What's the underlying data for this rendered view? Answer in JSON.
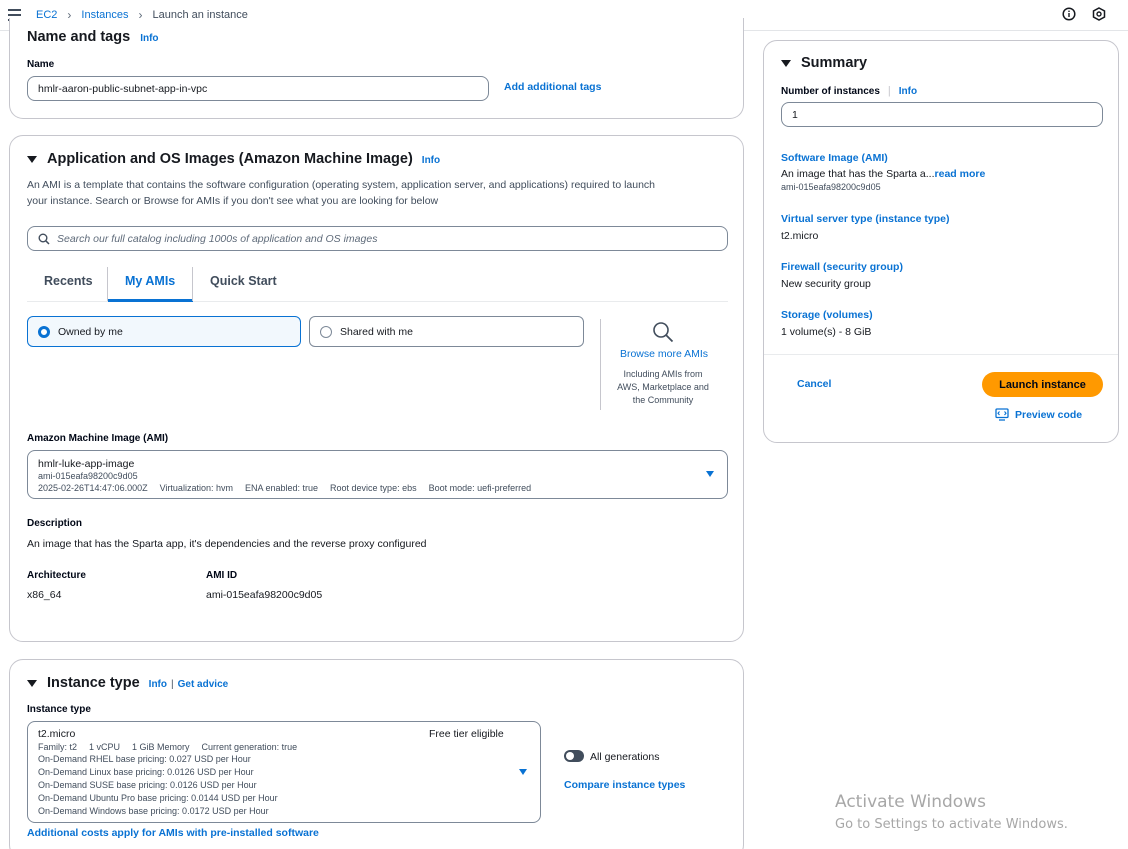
{
  "breadcrumb": {
    "ec2": "EC2",
    "instances": "Instances",
    "current": "Launch an instance"
  },
  "name_tags": {
    "title": "Name and tags",
    "info": "Info",
    "name_label": "Name",
    "name_value": "hmlr-aaron-public-subnet-app-in-vpc",
    "add_tags": "Add additional tags"
  },
  "ami_section": {
    "title": "Application and OS Images (Amazon Machine Image)",
    "info": "Info",
    "desc_line1": "An AMI is a template that contains the software configuration (operating system, application server, and applications) required to launch",
    "desc_line2": "your instance. Search or Browse for AMIs if you don't see what you are looking for below",
    "search_placeholder": "Search our full catalog including 1000s of application and OS images",
    "tabs": [
      "Recents",
      "My AMIs",
      "Quick Start"
    ],
    "owned_by_me": "Owned by me",
    "shared_with_me": "Shared with me",
    "browse_more": "Browse more AMIs",
    "browse_sub1": "Including AMIs from",
    "browse_sub2": "AWS, Marketplace and",
    "browse_sub3": "the Community",
    "ami_label": "Amazon Machine Image (AMI)",
    "ami_name": "hmlr-luke-app-image",
    "ami_id_line": "ami-015eafa98200c9d05",
    "ami_meta": {
      "date": "2025-02-26T14:47:06.000Z",
      "virt": "Virtualization: hvm",
      "ena": "ENA enabled: true",
      "root": "Root device type: ebs",
      "boot": "Boot mode: uefi-preferred"
    },
    "description_label": "Description",
    "description": "An image that has the Sparta app, it's dependencies and the reverse proxy configured",
    "arch_label": "Architecture",
    "arch_value": "x86_64",
    "amiid_label": "AMI ID",
    "amiid_value": "ami-015eafa98200c9d05"
  },
  "instance_type": {
    "title": "Instance type",
    "info": "Info",
    "get_advice": "Get advice",
    "label": "Instance type",
    "selected": "t2.micro",
    "free_tier": "Free tier eligible",
    "family_line": {
      "family": "Family: t2",
      "vcpu": "1 vCPU",
      "memory": "1 GiB Memory",
      "generation": "Current generation: true"
    },
    "pricing": [
      "On-Demand RHEL base pricing: 0.027 USD per Hour",
      "On-Demand Linux base pricing: 0.0126 USD per Hour",
      "On-Demand SUSE base pricing: 0.0126 USD per Hour",
      "On-Demand Ubuntu Pro base pricing: 0.0144 USD per Hour",
      "On-Demand Windows base pricing: 0.0172 USD per Hour"
    ],
    "all_generations": "All generations",
    "compare": "Compare instance types",
    "additional_costs": "Additional costs apply for AMIs with pre-installed software"
  },
  "summary": {
    "title": "Summary",
    "num_label": "Number of instances",
    "info": "Info",
    "num_value": "1",
    "software_label": "Software Image (AMI)",
    "software_value": "An image that has the Sparta a...",
    "read_more": "read more",
    "software_id": "ami-015eafa98200c9d05",
    "vst_label": "Virtual server type (instance type)",
    "vst_value": "t2.micro",
    "fw_label": "Firewall (security group)",
    "fw_value": "New security group",
    "storage_label": "Storage (volumes)",
    "storage_value": "1 volume(s) - 8 GiB",
    "cancel": "Cancel",
    "launch": "Launch instance",
    "preview": "Preview code"
  },
  "watermark": {
    "line1": "Activate Windows",
    "line2": "Go to Settings to activate Windows."
  }
}
